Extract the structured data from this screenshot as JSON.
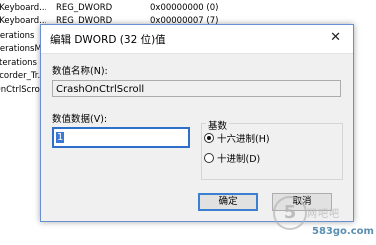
{
  "background_rows": [
    {
      "name": "eKeyboard...",
      "type": "REG_DWORD",
      "data": "0x00000000 (0)"
    },
    {
      "name": "eKeyboard...",
      "type": "REG_DWORD",
      "data": "0x00000007 (7)"
    },
    {
      "name": "Iterations",
      "type": "",
      "data": ""
    },
    {
      "name": "IterationsM...",
      "type": "",
      "data": ""
    },
    {
      "name": "IIterations",
      "type": "",
      "data": ""
    },
    {
      "name": "ecorder_Tr...",
      "type": "",
      "data": ""
    },
    {
      "name": "OnCtrlScroll",
      "type": "",
      "data": ""
    }
  ],
  "dialog": {
    "title": "编辑 DWORD (32 位)值",
    "close_glyph": "✕",
    "value_name_label": "数值名称(N):",
    "value_name": "CrashOnCtrlScroll",
    "value_data_label": "数值数据(V):",
    "value_data": "1",
    "base_label": "基数",
    "base_options": [
      {
        "label": "十六进制(H)",
        "selected": true
      },
      {
        "label": "十进制(D)",
        "selected": false
      }
    ],
    "ok_label": "确定",
    "cancel_label": "取消"
  },
  "watermark": {
    "logo_char": "5",
    "text": "网吧吧",
    "url": "583go.com"
  }
}
